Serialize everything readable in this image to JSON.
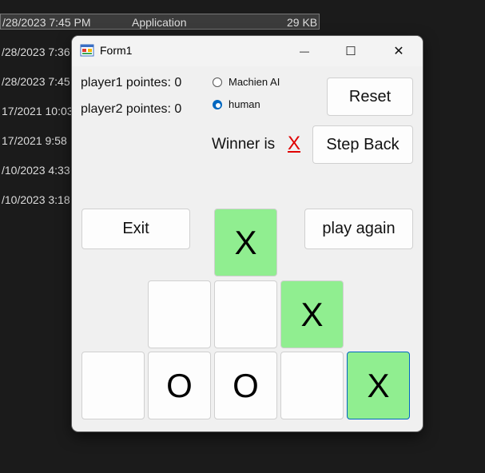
{
  "background_list": {
    "rows": [
      {
        "date": "/28/2023 7:45 PM",
        "type": "Application",
        "size": "29 KB"
      },
      {
        "date": "/28/2023 7:36"
      },
      {
        "date": "/28/2023 7:45"
      },
      {
        "date": "17/2021 10:03"
      },
      {
        "date": "17/2021 9:58"
      },
      {
        "date": "/10/2023 4:33"
      },
      {
        "date": "/10/2023 3:18"
      }
    ]
  },
  "window": {
    "title": "Form1",
    "minimize_glyph": "—",
    "maximize_glyph": "☐",
    "close_glyph": "✕"
  },
  "score": {
    "player1": "player1 pointes: 0",
    "player2": "player2 pointes: 0"
  },
  "mode": {
    "options": [
      {
        "label": "Machien AI",
        "selected": false
      },
      {
        "label": "human",
        "selected": true
      }
    ]
  },
  "winner": {
    "label": "Winner is",
    "mark": "X",
    "mark_color": "#e00000"
  },
  "buttons": {
    "reset": "Reset",
    "step_back": "Step Back",
    "exit": "Exit",
    "play_again": "play again"
  },
  "board": {
    "highlight_color": "#90ee90",
    "cells": [
      {
        "value": "X",
        "highlight": true
      },
      {
        "value": "",
        "highlight": false
      },
      {
        "value": "",
        "highlight": false
      },
      {
        "value": "X",
        "highlight": true
      },
      {
        "value": "",
        "highlight": false
      },
      {
        "value": "O",
        "highlight": false
      },
      {
        "value": "O",
        "highlight": false
      },
      {
        "value": "",
        "highlight": false
      },
      {
        "value": "X",
        "highlight": true
      }
    ]
  }
}
